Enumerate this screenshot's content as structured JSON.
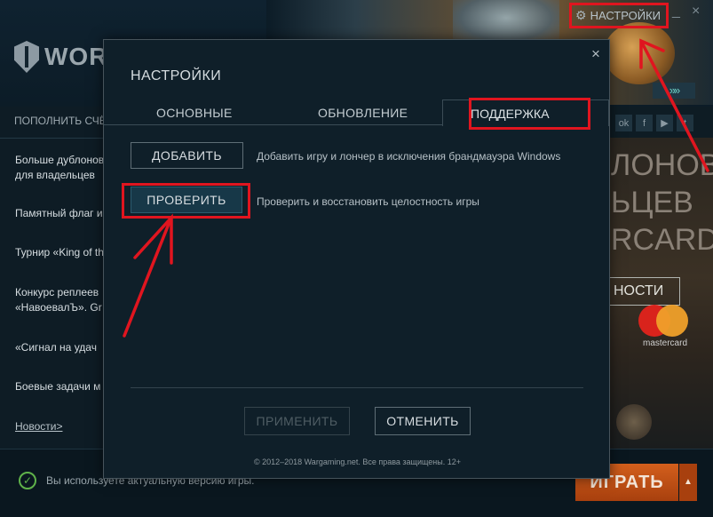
{
  "launcher": {
    "logo_text": "WORLD",
    "settings_label": "НАСТРОЙКИ",
    "replenish_label": "ПОПОЛНИТЬ СЧЁТ",
    "news": [
      "Больше дублонов\nдля владельцев",
      "Памятный флаг и",
      "Турнир «King of th",
      "Конкурс реплеев\n«НавоевалЪ». Gr",
      "«Сигнал на удач",
      "Боевые задачи м"
    ],
    "news_link": "Новости>",
    "social": [
      "ok",
      "f",
      "▶",
      "t"
    ],
    "promo_lines": [
      "ЛОНОВ",
      "ЬЦЕВ",
      "RCARD"
    ],
    "promo_button": "НОСТИ",
    "mastercard": "mastercard",
    "status_text": "Вы используете актуальную версию игры.",
    "play_label": "ИГРАТЬ"
  },
  "dialog": {
    "title": "НАСТРОЙКИ",
    "close": "×",
    "tabs": [
      "ОСНОВНЫЕ",
      "ОБНОВЛЕНИЕ",
      "ПОДДЕРЖКА"
    ],
    "active_tab": "ПОДДЕРЖКА",
    "actions": [
      {
        "button": "ДОБАВИТЬ",
        "description": "Добавить игру и лончер в исключения брандмауэра Windows"
      },
      {
        "button": "ПРОВЕРИТЬ",
        "description": "Проверить и восстановить целостность игры"
      }
    ],
    "apply_label": "ПРИМЕНИТЬ",
    "cancel_label": "ОТМЕНИТЬ",
    "copyright": "© 2012–2018 Wargaming.net. Все права защищены. 12+"
  },
  "colors": {
    "highlight": "#e0151f",
    "play_button": "#c4541a",
    "status_ok": "#5fb24a"
  }
}
